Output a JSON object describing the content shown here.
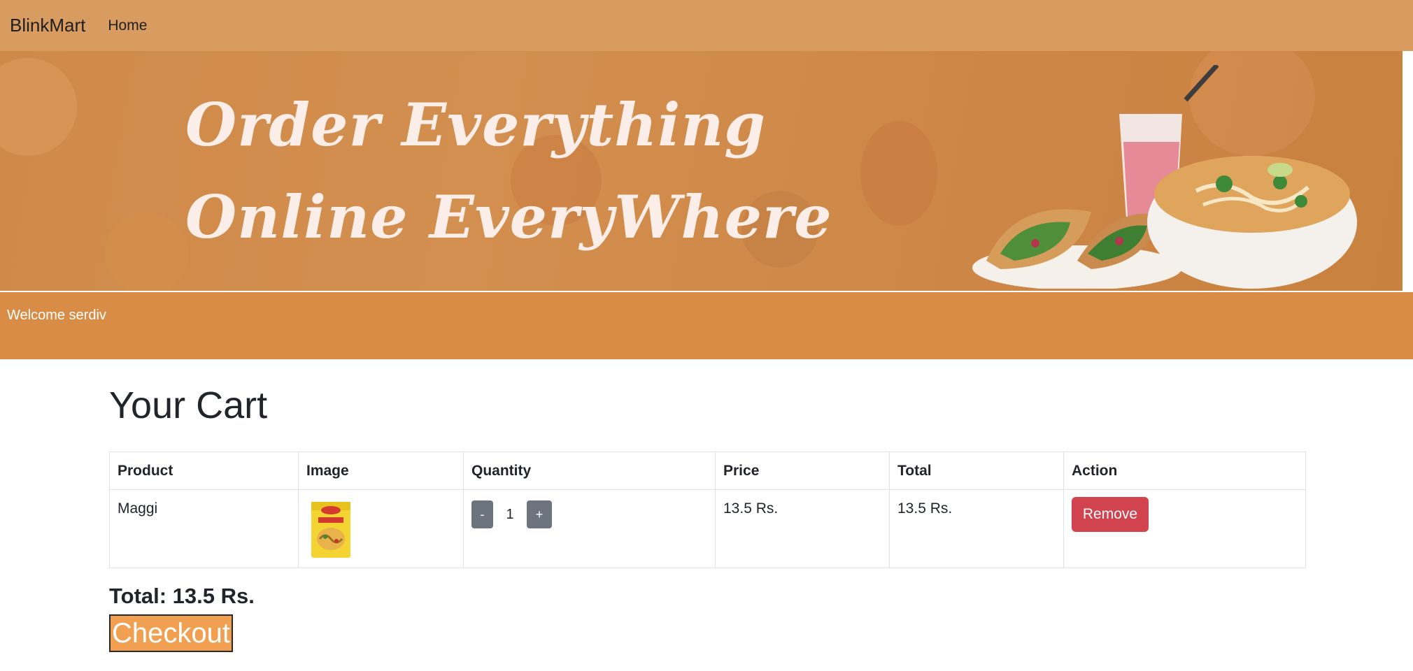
{
  "navbar": {
    "brand": "BlinkMart",
    "links": [
      "Home"
    ]
  },
  "banner": {
    "line1": "Order Everything",
    "line2": "Online EveryWhere"
  },
  "welcome": {
    "text": "Welcome serdiv"
  },
  "cart": {
    "title": "Your Cart",
    "columns": [
      "Product",
      "Image",
      "Quantity",
      "Price",
      "Total",
      "Action"
    ],
    "rows": [
      {
        "product": "Maggi",
        "image_icon": "maggi-package-image",
        "minus": "-",
        "quantity": "1",
        "plus": "+",
        "price": "13.5 Rs.",
        "total": "13.5 Rs.",
        "action": "Remove"
      }
    ],
    "grand_total": "Total: 13.5 Rs.",
    "checkout_label": "Checkout"
  },
  "colors": {
    "navbar": "#d99c60",
    "banner": "#cf8a4a",
    "welcome_bar": "#d98c45",
    "remove_button": "#d1434f",
    "quantity_button": "#6c757d",
    "checkout_button": "#f0a050"
  }
}
